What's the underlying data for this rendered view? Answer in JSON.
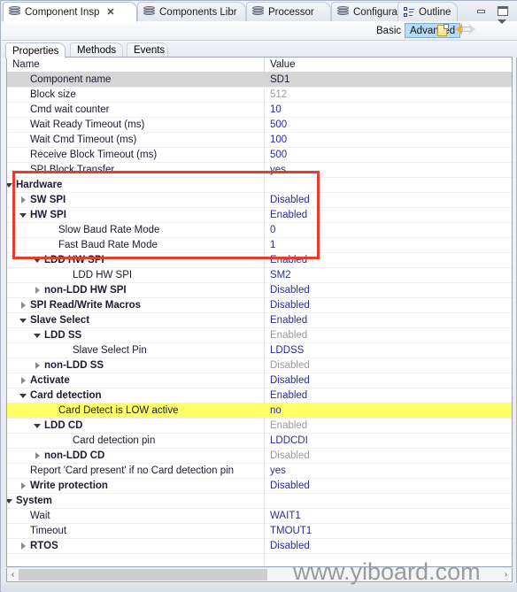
{
  "window": {
    "minimize_label": "minimize",
    "maximize_label": "maximize"
  },
  "tabs": [
    {
      "label": "Component Insp",
      "icon": "component-icon",
      "active": true,
      "closable": true,
      "close_label": "✕"
    },
    {
      "label": "Components Libr",
      "icon": "component-icon",
      "active": false,
      "closable": false
    },
    {
      "label": "Processor",
      "icon": "component-icon",
      "active": false,
      "closable": false
    },
    {
      "label": "Configuration Re",
      "icon": "component-icon",
      "active": false,
      "closable": false
    },
    {
      "label": "Outline",
      "icon": "outline-icon",
      "active": false,
      "closable": false
    }
  ],
  "toolbar": {
    "basic_label": "Basic",
    "advanced_label": "Advanced",
    "advanced_selected": true,
    "icons": [
      "new-page-icon",
      "back-arrow-icon",
      "forward-arrow-icon",
      "view-menu-chevron-icon"
    ]
  },
  "subtabs": [
    {
      "label": "Properties",
      "active": true
    },
    {
      "label": "Methods",
      "active": false
    },
    {
      "label": "Events",
      "active": false
    }
  ],
  "table": {
    "columns": [
      "Name",
      "Value"
    ],
    "rows": [
      {
        "name": "Component name",
        "value": "SD1",
        "indent": 1,
        "twisty": "none",
        "bold": false,
        "state": "selected",
        "valueState": "normal"
      },
      {
        "name": "Block size",
        "value": "512",
        "indent": 1,
        "twisty": "none",
        "bold": false,
        "state": "normal",
        "valueState": "dim"
      },
      {
        "name": "Cmd wait counter",
        "value": "10",
        "indent": 1,
        "twisty": "none",
        "bold": false,
        "state": "normal",
        "valueState": "normal"
      },
      {
        "name": "Wait Ready Timeout (ms)",
        "value": "500",
        "indent": 1,
        "twisty": "none",
        "bold": false,
        "state": "normal",
        "valueState": "normal"
      },
      {
        "name": "Wait Cmd Timeout (ms)",
        "value": "100",
        "indent": 1,
        "twisty": "none",
        "bold": false,
        "state": "normal",
        "valueState": "normal"
      },
      {
        "name": "Receive Block Timeout (ms)",
        "value": "500",
        "indent": 1,
        "twisty": "none",
        "bold": false,
        "state": "normal",
        "valueState": "normal"
      },
      {
        "name": "SPI Block Transfer",
        "value": "yes",
        "indent": 1,
        "twisty": "none",
        "bold": false,
        "state": "normal",
        "valueState": "normal"
      },
      {
        "name": "Hardware",
        "value": "",
        "indent": 0,
        "twisty": "expanded",
        "bold": true,
        "state": "normal",
        "valueState": "normal"
      },
      {
        "name": "SW SPI",
        "value": "Disabled",
        "indent": 1,
        "twisty": "collapsed",
        "bold": true,
        "state": "normal",
        "valueState": "normal"
      },
      {
        "name": "HW SPI",
        "value": "Enabled",
        "indent": 1,
        "twisty": "expanded",
        "bold": true,
        "state": "normal",
        "valueState": "normal"
      },
      {
        "name": "Slow Baud Rate Mode",
        "value": "0",
        "indent": 3,
        "twisty": "none",
        "bold": false,
        "state": "normal",
        "valueState": "normal"
      },
      {
        "name": "Fast Baud Rate Mode",
        "value": "1",
        "indent": 3,
        "twisty": "none",
        "bold": false,
        "state": "normal",
        "valueState": "normal"
      },
      {
        "name": "LDD HW SPI",
        "value": "Enabled",
        "indent": 2,
        "twisty": "expanded",
        "bold": true,
        "state": "normal",
        "valueState": "normal"
      },
      {
        "name": "LDD HW SPI",
        "value": "SM2",
        "indent": 4,
        "twisty": "none",
        "bold": false,
        "state": "normal",
        "valueState": "normal"
      },
      {
        "name": "non-LDD HW SPI",
        "value": "Disabled",
        "indent": 2,
        "twisty": "collapsed",
        "bold": true,
        "state": "normal",
        "valueState": "normal"
      },
      {
        "name": "SPI Read/Write Macros",
        "value": "Disabled",
        "indent": 1,
        "twisty": "collapsed",
        "bold": true,
        "state": "normal",
        "valueState": "normal"
      },
      {
        "name": "Slave Select",
        "value": "Enabled",
        "indent": 1,
        "twisty": "expanded",
        "bold": true,
        "state": "normal",
        "valueState": "normal"
      },
      {
        "name": "LDD SS",
        "value": "Enabled",
        "indent": 2,
        "twisty": "expanded",
        "bold": true,
        "state": "normal",
        "valueState": "dim"
      },
      {
        "name": "Slave Select Pin",
        "value": "LDDSS",
        "indent": 4,
        "twisty": "none",
        "bold": false,
        "state": "normal",
        "valueState": "normal"
      },
      {
        "name": "non-LDD SS",
        "value": "Disabled",
        "indent": 2,
        "twisty": "collapsed",
        "bold": true,
        "state": "normal",
        "valueState": "dim"
      },
      {
        "name": "Activate",
        "value": "Disabled",
        "indent": 1,
        "twisty": "collapsed",
        "bold": true,
        "state": "normal",
        "valueState": "normal"
      },
      {
        "name": "Card detection",
        "value": "Enabled",
        "indent": 1,
        "twisty": "expanded",
        "bold": true,
        "state": "normal",
        "valueState": "normal"
      },
      {
        "name": "Card Detect is LOW active",
        "value": "no",
        "indent": 3,
        "twisty": "none",
        "bold": false,
        "state": "highlight",
        "valueState": "normal"
      },
      {
        "name": "LDD CD",
        "value": "Enabled",
        "indent": 2,
        "twisty": "expanded",
        "bold": true,
        "state": "normal",
        "valueState": "dim"
      },
      {
        "name": "Card detection pin",
        "value": "LDDCDI",
        "indent": 4,
        "twisty": "none",
        "bold": false,
        "state": "normal",
        "valueState": "normal"
      },
      {
        "name": "non-LDD CD",
        "value": "Disabled",
        "indent": 2,
        "twisty": "collapsed",
        "bold": true,
        "state": "normal",
        "valueState": "dim"
      },
      {
        "name": "Report 'Card present' if no Card detection pin",
        "value": "yes",
        "indent": 1,
        "twisty": "none",
        "bold": false,
        "state": "normal",
        "valueState": "normal"
      },
      {
        "name": "Write protection",
        "value": "Disabled",
        "indent": 1,
        "twisty": "collapsed",
        "bold": true,
        "state": "normal",
        "valueState": "normal"
      },
      {
        "name": "System",
        "value": "",
        "indent": 0,
        "twisty": "expanded",
        "bold": true,
        "state": "normal",
        "valueState": "normal"
      },
      {
        "name": "Wait",
        "value": "WAIT1",
        "indent": 1,
        "twisty": "none",
        "bold": false,
        "state": "normal",
        "valueState": "normal"
      },
      {
        "name": "Timeout",
        "value": "TMOUT1",
        "indent": 1,
        "twisty": "none",
        "bold": false,
        "state": "normal",
        "valueState": "normal"
      },
      {
        "name": "RTOS",
        "value": "Disabled",
        "indent": 1,
        "twisty": "collapsed",
        "bold": true,
        "state": "normal",
        "valueState": "normal"
      }
    ]
  },
  "annotation": {
    "color": "#e83b2c",
    "highlight_color": "#ffff66"
  },
  "scrollbar": {
    "left_arrow": "‹",
    "right_arrow": "›"
  },
  "watermark": {
    "text": "www.yiboard.com"
  }
}
